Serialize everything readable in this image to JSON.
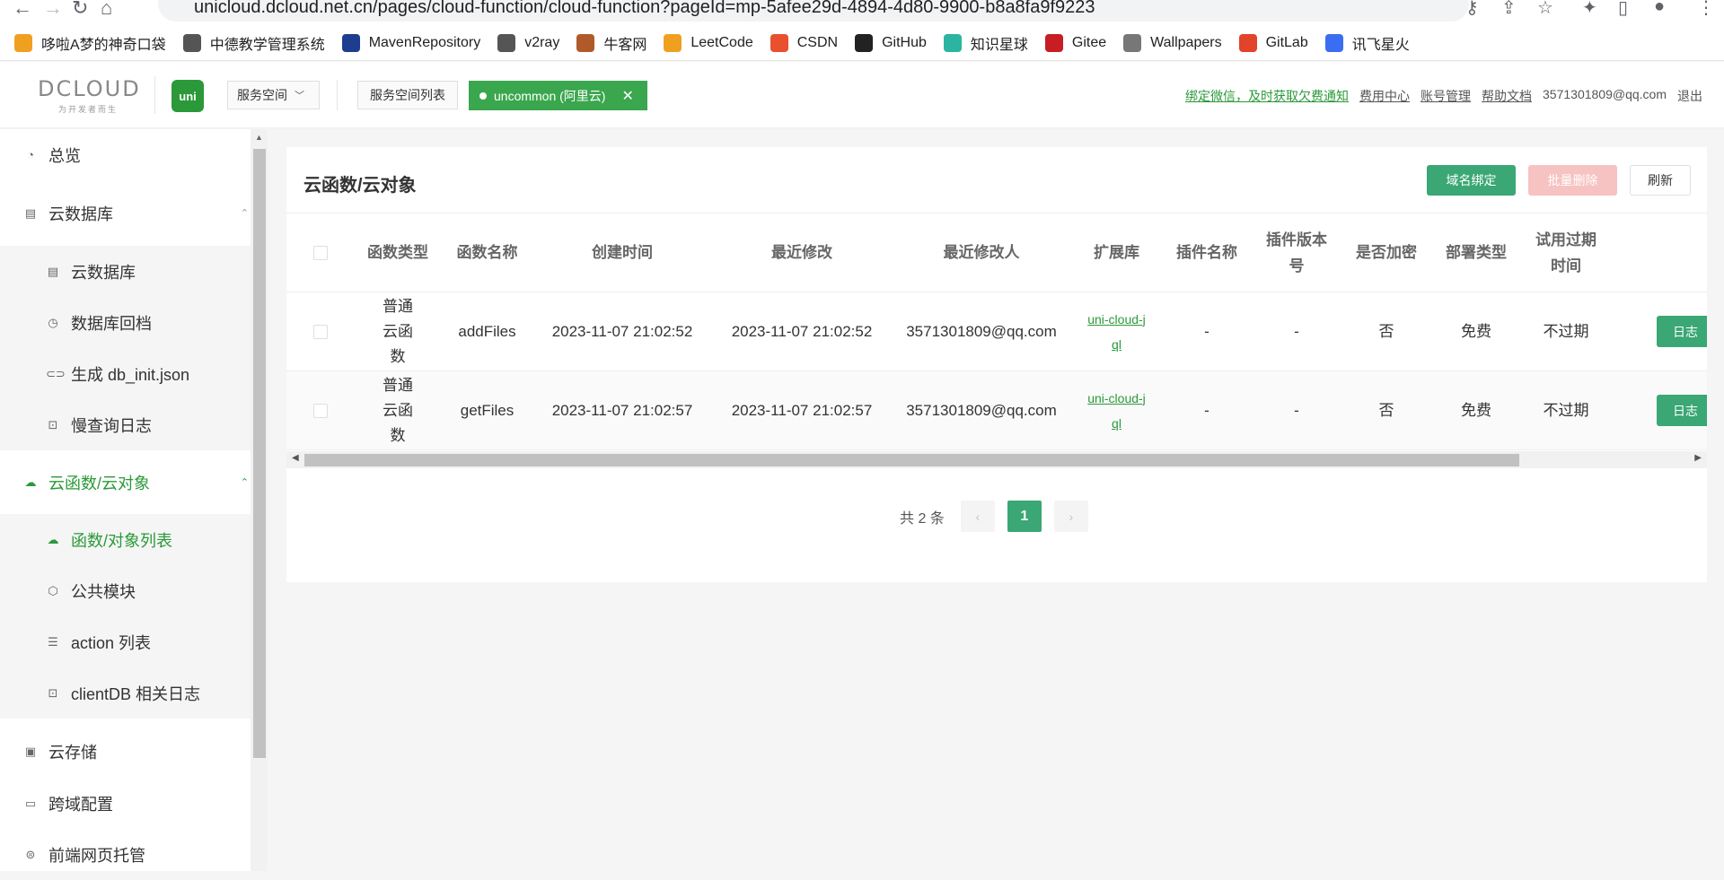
{
  "browser": {
    "url": "unicloud.dcloud.net.cn/pages/cloud-function/cloud-function?pageId=mp-5afee29d-4894-4d80-9900-b8a8fa9f9223",
    "bookmarks": [
      {
        "label": "哆啦A梦的神奇口袋",
        "icon": "doraemon-icon",
        "color": "#f0a020"
      },
      {
        "label": "中德教学管理系统",
        "icon": "globe-icon",
        "color": "#555555"
      },
      {
        "label": "MavenRepository",
        "icon": "maven-icon",
        "color": "#1d3d8f"
      },
      {
        "label": "v2ray",
        "icon": "globe-icon",
        "color": "#555555"
      },
      {
        "label": "牛客网",
        "icon": "nowcoder-icon",
        "color": "#b05a2a"
      },
      {
        "label": "LeetCode",
        "icon": "leetcode-icon",
        "color": "#f0a020"
      },
      {
        "label": "CSDN",
        "icon": "csdn-icon",
        "color": "#e8502e"
      },
      {
        "label": "GitHub",
        "icon": "github-icon",
        "color": "#222222"
      },
      {
        "label": "知识星球",
        "icon": "zsxq-icon",
        "color": "#2bb5a0"
      },
      {
        "label": "Gitee",
        "icon": "gitee-icon",
        "color": "#c71d23"
      },
      {
        "label": "Wallpapers",
        "icon": "wallpapers-icon",
        "color": "#777777"
      },
      {
        "label": "GitLab",
        "icon": "gitlab-icon",
        "color": "#e2432a"
      },
      {
        "label": "讯飞星火",
        "icon": "xfyun-icon",
        "color": "#3b6df2"
      }
    ]
  },
  "header": {
    "logo_text": "DCLOUD",
    "logo_sub": "为开发者而生",
    "uni_logo": "uni",
    "space_select": "服务空间",
    "space_list": "服务空间列表",
    "space_tag": "uncommon (阿里云)",
    "links": {
      "bind_wechat": "绑定微信，及时获取欠费通知",
      "billing": "费用中心",
      "account": "账号管理",
      "help": "帮助文档",
      "email": "3571301809@qq.com",
      "logout": "退出"
    }
  },
  "sidebar": {
    "items": [
      {
        "label": "总览",
        "icon": "dashboard-icon"
      },
      {
        "label": "云数据库",
        "icon": "database-icon"
      },
      {
        "label": "云数据库",
        "icon": "table-icon"
      },
      {
        "label": "数据库回档",
        "icon": "restore-icon"
      },
      {
        "label": "生成 db_init.json",
        "icon": "link-icon"
      },
      {
        "label": "慢查询日志",
        "icon": "log-icon"
      },
      {
        "label": "云函数/云对象",
        "icon": "cloud-icon"
      },
      {
        "label": "函数/对象列表",
        "icon": "cloud-icon"
      },
      {
        "label": "公共模块",
        "icon": "cube-icon"
      },
      {
        "label": "action 列表",
        "icon": "list-icon"
      },
      {
        "label": "clientDB 相关日志",
        "icon": "log-icon"
      },
      {
        "label": "云存储",
        "icon": "storage-icon"
      },
      {
        "label": "跨域配置",
        "icon": "cors-icon"
      },
      {
        "label": "前端网页托管",
        "icon": "hosting-icon"
      }
    ]
  },
  "main": {
    "title": "云函数/云对象",
    "actions": {
      "domain_bind": "域名绑定",
      "batch_delete": "批量删除",
      "refresh": "刷新"
    },
    "table": {
      "headers": [
        "函数类型",
        "函数名称",
        "创建时间",
        "最近修改",
        "最近修改人",
        "扩展库",
        "插件名称",
        "插件版本号",
        "是否加密",
        "部署类型",
        "试用过期时间"
      ],
      "rows": [
        {
          "type": "普通云函数",
          "name": "addFiles",
          "created": "2023-11-07 21:02:52",
          "modified": "2023-11-07 21:02:52",
          "modifier": "3571301809@qq.com",
          "ext_lib": "uni-cloud-jql",
          "plugin_name": "-",
          "plugin_version": "-",
          "encrypted": "否",
          "deploy_type": "免费",
          "trial_expire": "不过期",
          "action": "日志"
        },
        {
          "type": "普通云函数",
          "name": "getFiles",
          "created": "2023-11-07 21:02:57",
          "modified": "2023-11-07 21:02:57",
          "modifier": "3571301809@qq.com",
          "ext_lib": "uni-cloud-jql",
          "plugin_name": "-",
          "plugin_version": "-",
          "encrypted": "否",
          "deploy_type": "免费",
          "trial_expire": "不过期",
          "action": "日志"
        }
      ]
    },
    "pagination": {
      "total_text": "共 2 条",
      "current_page": "1",
      "prev": "‹",
      "next": "›"
    }
  },
  "colors": {
    "brand_green": "#3aa774",
    "link_green": "#2b9939",
    "danger_light": "#f7c2c2"
  }
}
